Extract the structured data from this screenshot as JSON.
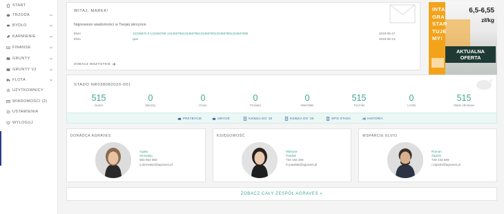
{
  "sidebar": {
    "items": [
      {
        "label": "START",
        "icon": "home-icon",
        "chevron": false
      },
      {
        "label": "TRZODA",
        "icon": "pig-icon",
        "chevron": true
      },
      {
        "label": "BYDŁO",
        "icon": "cow-icon",
        "chevron": true
      },
      {
        "label": "KARMIENIE",
        "icon": "leaf-icon",
        "chevron": true
      },
      {
        "label": "FINANSE",
        "icon": "money-icon",
        "chevron": true
      },
      {
        "label": "GRUNTY",
        "icon": "map-icon",
        "chevron": true
      },
      {
        "label": "GRUNTY V2",
        "icon": "map-icon",
        "chevron": true
      },
      {
        "label": "FLOTA",
        "icon": "truck-icon",
        "chevron": true
      },
      {
        "label": "UŻYTKOWNICY",
        "icon": "users-icon",
        "chevron": false
      },
      {
        "label": "WIADOMOŚCI (2)",
        "icon": "envelope-icon",
        "chevron": false
      },
      {
        "label": "USTAWIENIA",
        "icon": "gear-icon",
        "chevron": false
      },
      {
        "label": "WYLOGUJ",
        "icon": "heart-icon",
        "chevron": false
      }
    ]
  },
  "welcome": {
    "title": "WITAJ, MAREK!",
    "subtitle": "Najnowsze wiadomości w Twojej skrzynce",
    "messages": [
      {
        "from": "Elvio",
        "subject": "12345678 9 123456789 1234567891234567891234567891234567891234567890",
        "date": "2019-06-27"
      },
      {
        "from": "Elvio",
        "subject": "qwe",
        "date": "2019-06-13"
      }
    ],
    "see_all": "ZOBACZ WSZYSTKIE"
  },
  "ad": {
    "headline_lines": [
      "INTA",
      "GRA",
      "STAR",
      "TUJE",
      "MY!"
    ],
    "price": "6,5-6,55",
    "unit": "zł/kg",
    "badge_line1": "AKTUALNA",
    "badge_line2": "OFERTA",
    "colors": {
      "orange": "#f2a31b",
      "dark": "#1f3a34"
    }
  },
  "herd": {
    "title": "STADO NR038082020-001",
    "stats": [
      {
        "value": "515",
        "label": "lsuma"
      },
      {
        "value": "0",
        "label": "Maciory"
      },
      {
        "value": "0",
        "label": "Knury"
      },
      {
        "value": "0",
        "label": "Prosięta"
      },
      {
        "value": "0",
        "label": "Warchlaki"
      },
      {
        "value": "515",
        "label": "Tuczniki"
      },
      {
        "value": "0",
        "label": "Loszki"
      },
      {
        "value": "515",
        "label": "Stado obrotowe"
      }
    ],
    "toolbar": [
      {
        "label": "PRZYBYCIE",
        "icon": "pig-icon"
      },
      {
        "label": "UBYCIE",
        "icon": "pig-icon"
      },
      {
        "label": "KSIĘGA DO '18",
        "icon": "book-icon"
      },
      {
        "label": "KSIĘGA DO '19",
        "icon": "book-icon"
      },
      {
        "label": "SPIS STADA",
        "icon": "list-icon"
      },
      {
        "label": "HISTORIA",
        "icon": "history-icon"
      }
    ]
  },
  "people": [
    {
      "heading": "DORADCA AGRAVES",
      "first": "Agata",
      "last": "Strowiejo",
      "phone": "660 554 058",
      "email": "a.strowiejo@agraves.pl"
    },
    {
      "heading": "KSIĘGOWOŚĆ",
      "first": "Martyna",
      "last": "Pawlak",
      "phone": "734 192 268",
      "email": "m.pawlak@agraves.pl"
    },
    {
      "heading": "WSPARCIE ELVIO",
      "first": "Roman",
      "last": "Zapolo",
      "phone": "728 433 569",
      "email": "r.zapolo@agraves.pl"
    }
  ],
  "team_link": "ZOBACZ CAŁY ZESPÓŁ AGRAVES »",
  "colors": {
    "accent": "#3ea692",
    "link_blue": "#3b6aa0",
    "sidebar_accent": "#2b3b8e"
  }
}
